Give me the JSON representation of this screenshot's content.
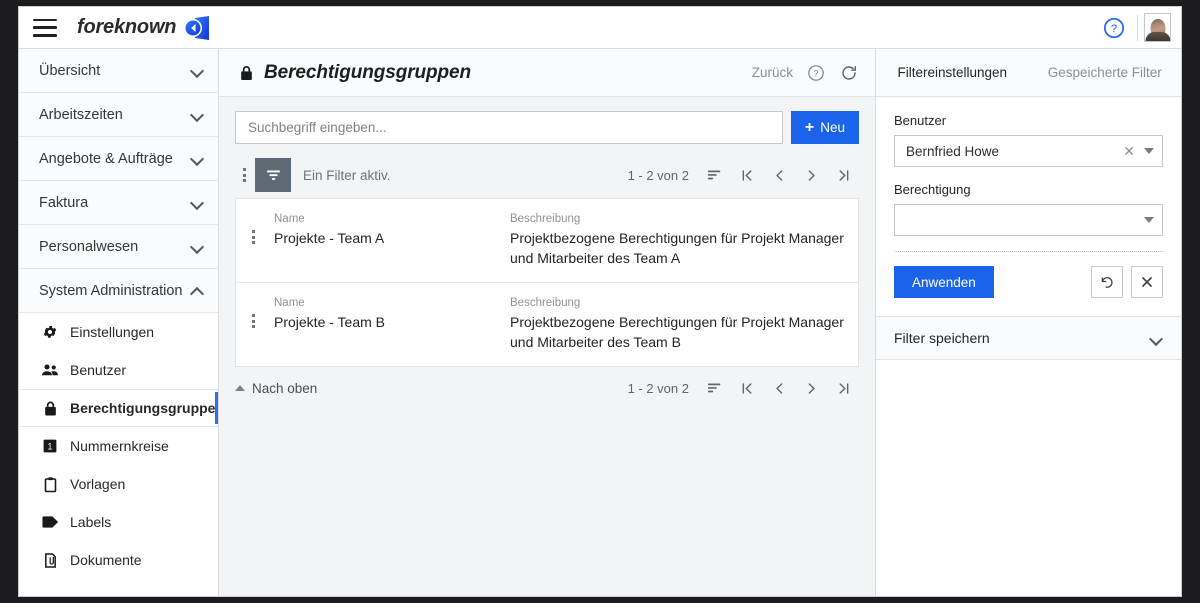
{
  "topbar": {
    "menu_icon": "hamburger-icon",
    "brand": "foreknown",
    "logo_icon": "foreknown-logo",
    "help_icon": "help-circle-icon",
    "avatar_icon": "user-avatar"
  },
  "sidebar": {
    "groups": [
      {
        "label": "Übersicht",
        "expanded": false
      },
      {
        "label": "Arbeitszeiten",
        "expanded": false
      },
      {
        "label": "Angebote & Aufträge",
        "expanded": false
      },
      {
        "label": "Faktura",
        "expanded": false
      },
      {
        "label": "Personalwesen",
        "expanded": false
      },
      {
        "label": "System Administration",
        "expanded": true
      }
    ],
    "items": [
      {
        "label": "Einstellungen",
        "icon": "gear-icon",
        "active": false
      },
      {
        "label": "Benutzer",
        "icon": "people-icon",
        "active": false
      },
      {
        "label": "Berechtigungsgruppen",
        "icon": "lock-icon",
        "active": true
      },
      {
        "label": "Nummernkreise",
        "icon": "number-box-icon",
        "active": false
      },
      {
        "label": "Vorlagen",
        "icon": "clipboard-icon",
        "active": false
      },
      {
        "label": "Labels",
        "icon": "tag-icon",
        "active": false
      },
      {
        "label": "Dokumente",
        "icon": "document-icon",
        "active": false
      }
    ]
  },
  "main": {
    "title": "Berechtigungsgruppen",
    "title_icon": "lock-icon",
    "back_label": "Zurück",
    "help_icon": "help-circle-icon",
    "refresh_icon": "refresh-icon",
    "search": {
      "placeholder": "Suchbegriff eingeben...",
      "value": ""
    },
    "new_button": {
      "label": "Neu",
      "plus": "+"
    },
    "toolbar": {
      "kebab_icon": "more-vertical-icon",
      "filter_icon": "filter-funnel-icon",
      "filter_status": "Ein Filter aktiv.",
      "count": "1 - 2 von 2",
      "sort_icon": "sort-icon",
      "first_icon": "first-page-icon",
      "prev_icon": "prev-page-icon",
      "next_icon": "next-page-icon",
      "last_icon": "last-page-icon"
    },
    "columns": {
      "name": "Name",
      "description": "Beschreibung"
    },
    "rows": [
      {
        "name": "Projekte - Team A",
        "description": "Projektbezogene Berechtigungen für Projekt Manager und Mitarbeiter des Team A"
      },
      {
        "name": "Projekte - Team B",
        "description": "Projektbezogene Berechtigungen für Projekt Manager und Mitarbeiter des Team B"
      }
    ],
    "bottombar": {
      "top_label": "Nach oben",
      "count": "1 - 2 von 2"
    }
  },
  "panel": {
    "tabs": [
      {
        "label": "Filtereinstellungen",
        "active": true
      },
      {
        "label": "Gespeicherte Filter",
        "active": false
      }
    ],
    "fields": [
      {
        "label": "Benutzer",
        "value": "Bernfried Howe",
        "clearable": true
      },
      {
        "label": "Berechtigung",
        "value": "",
        "clearable": false
      }
    ],
    "apply_label": "Anwenden",
    "reset_icon": "undo-icon",
    "clear_icon": "close-icon",
    "save_filter_label": "Filter speichern"
  },
  "colors": {
    "accent_blue": "#1a63ea",
    "active_indicator": "#2f6df0",
    "filter_button": "#5e6a75",
    "muted_text": "#8b9097"
  }
}
